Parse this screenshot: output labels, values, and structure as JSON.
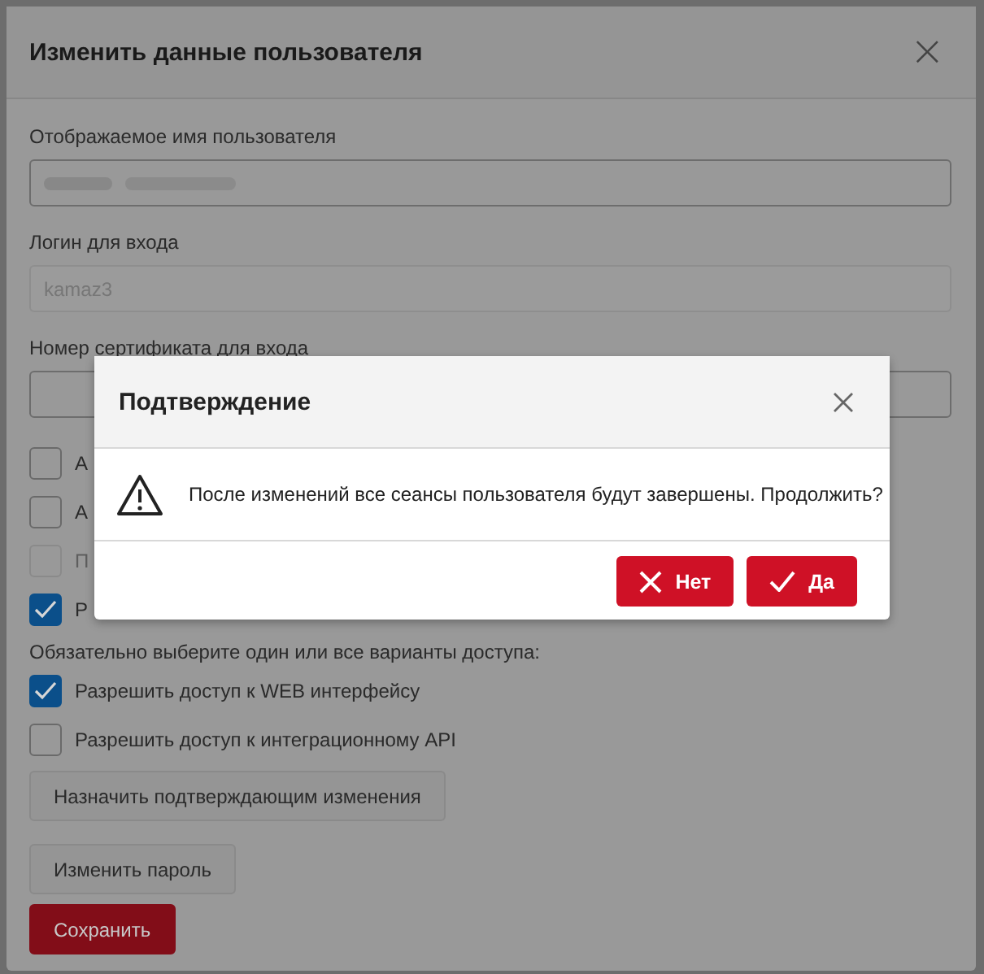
{
  "edit_dialog": {
    "title": "Изменить данные пользователя",
    "close": "×",
    "fields": [
      {
        "label": "Отображаемое имя пользователя",
        "kind": "redacted"
      },
      {
        "label": "Логин для входа",
        "kind": "disabled",
        "value": "kamaz3"
      },
      {
        "label": "Номер сертификата для входа",
        "kind": "text"
      }
    ],
    "checkboxes": [
      {
        "label": "А",
        "checked": false,
        "disabled": false
      },
      {
        "label": "А",
        "checked": false,
        "disabled": false
      },
      {
        "label": "П",
        "checked": false,
        "disabled": true
      },
      {
        "label": "Р",
        "checked": true,
        "disabled": false
      }
    ],
    "access_note": "Обязательно выберите один или все варианты доступа:",
    "access_options": [
      {
        "label": "Разрешить доступ к WEB интерфейсу",
        "checked": true
      },
      {
        "label": "Разрешить доступ к интеграционному API",
        "checked": false
      }
    ],
    "buttons": [
      {
        "label": "Назначить подтверждающим изменения",
        "kind": "secondary"
      },
      {
        "label": "Изменить пароль",
        "kind": "secondary"
      },
      {
        "label": "Сохранить",
        "kind": "primary"
      }
    ]
  },
  "confirm_dialog": {
    "title": "Подтверждение",
    "message": "После изменений все сеансы пользователя будут завершены. Продолжить?",
    "buttons": [
      {
        "label": "Нет",
        "kind": "no"
      },
      {
        "label": "Да",
        "kind": "yes"
      }
    ]
  }
}
